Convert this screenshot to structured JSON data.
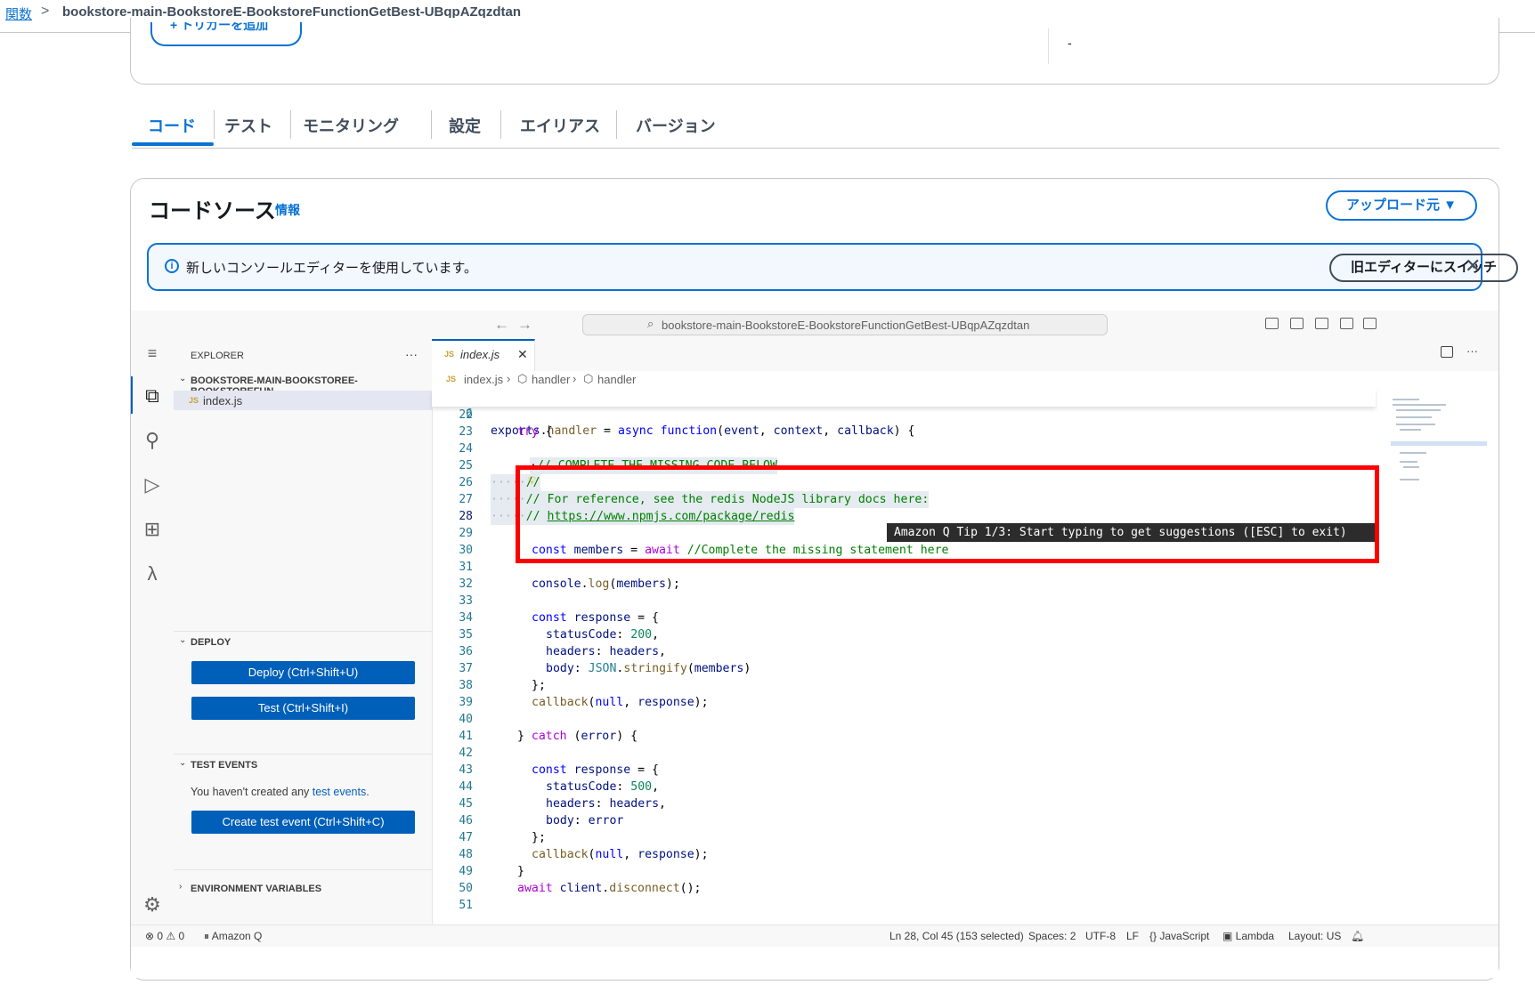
{
  "breadcrumb": {
    "link": "関数",
    "separator": ">",
    "current": "bookstore-main-BookstoreE-BookstoreFunctionGetBest-UBqpAZqzdtan"
  },
  "top_card": {
    "add_trigger": "+ トリガーを追加",
    "value": "-"
  },
  "tabs": [
    "コード",
    "テスト",
    "モニタリング",
    "設定",
    "エイリアス",
    "バージョン"
  ],
  "code_source": {
    "title": "コードソース",
    "info": "情報",
    "upload": "アップロード元 ▼",
    "banner_text": "新しいコンソールエディターを使用しています。",
    "switch_button": "旧エディターにスイッチ",
    "close": "✕"
  },
  "editor": {
    "command_center": "bookstore-main-BookstoreE-BookstoreFunctionGetBest-UBqpAZqzdtan",
    "explorer": {
      "title": "EXPLORER",
      "more": "···",
      "folder": "BOOKSTORE-MAIN-BOOKSTOREE-BOOKSTOREFUN...",
      "file": "index.js",
      "js_badge": "JS"
    },
    "deploy": {
      "title": "DEPLOY",
      "deploy_button": "Deploy (Ctrl+Shift+U)",
      "test_button": "Test (Ctrl+Shift+I)"
    },
    "test_events": {
      "title": "TEST EVENTS",
      "text": "You haven't created any ",
      "link": "test events",
      "period": ".",
      "create_button": "Create test event (Ctrl+Shift+C)"
    },
    "env_title": "ENVIRONMENT VARIABLES",
    "tab_name": "index.js",
    "crumbs": [
      "index.js",
      "handler",
      "handler"
    ],
    "sticky": {
      "num": "6",
      "code": "exports.handler = async function(event, context, callback) {"
    },
    "tip": "Amazon Q Tip 1/3: Start typing to get suggestions ([ESC] to exit)",
    "lines": [
      "22",
      "23",
      "24",
      "25",
      "26",
      "27",
      "28",
      "29",
      "30",
      "31",
      "32",
      "33",
      "34",
      "35",
      "36",
      "37",
      "38",
      "39",
      "40",
      "41",
      "42",
      "43",
      "44",
      "45",
      "46",
      "47",
      "48",
      "49",
      "50",
      "51"
    ],
    "code": {
      "l23": "try",
      "l25": "// COMPLETE THE MISSING CODE BELOW",
      "l26": "//",
      "l27": "// For reference, see the redis NodeJS library docs here:",
      "l28": "https://www.npmjs.com/package/redis",
      "l30_comment": "//Complete the missing statement here"
    },
    "status": {
      "problems": "⊗ 0 ⚠ 0",
      "amazon_q": "Amazon Q",
      "position": "Ln 28, Col 45 (153 selected)",
      "spaces": "Spaces: 2",
      "encoding": "UTF-8",
      "eol": "LF",
      "language": "JavaScript",
      "lambda": "Lambda",
      "layout": "Layout: US"
    }
  }
}
